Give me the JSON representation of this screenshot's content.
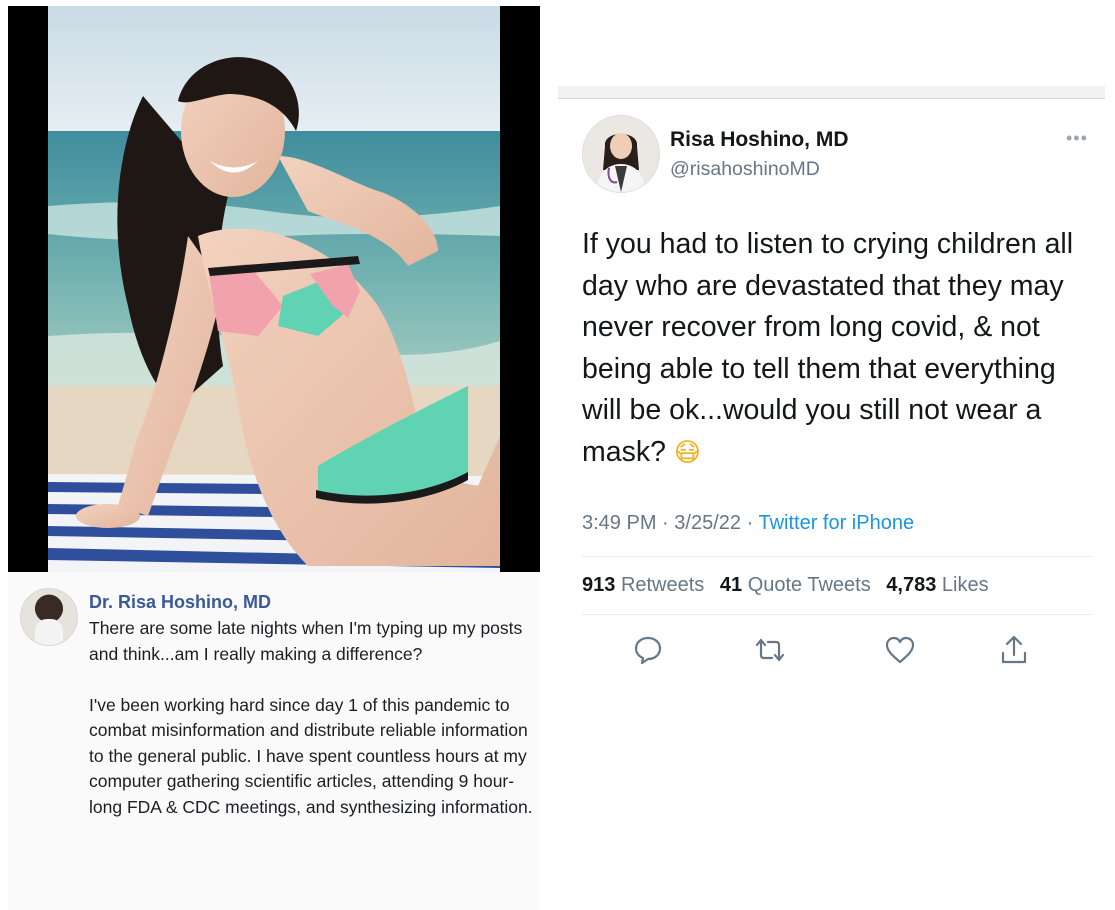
{
  "facebook_post": {
    "author": "Dr. Risa Hoshino, MD",
    "paragraphs": [
      "There are some late nights when I'm typing up my posts and think...am I really making a difference?",
      "I've been working hard since day 1 of this pandemic to combat misinformation and distribute reliable information to the general public. I have spent countless hours at my computer gathering scientific articles, attending 9 hour-long FDA & CDC meetings, and synthesizing information."
    ]
  },
  "tweet": {
    "name": "Risa Hoshino, MD",
    "handle": "@risahoshinoMD",
    "more_icon": "•••",
    "text": "If you had to listen to crying children all day who are devastated that they may never recover from long covid, & not being able to tell them that everything will be ok...would you still not wear a mask?",
    "emoji": "😷",
    "time": "3:49 PM",
    "date": "3/25/22",
    "dot": "·",
    "source": "Twitter for iPhone",
    "retweets_count": "913",
    "retweets_label": "Retweets",
    "quotes_count": "41",
    "quotes_label": "Quote Tweets",
    "likes_count": "4,783",
    "likes_label": "Likes",
    "actions": [
      "reply-icon",
      "retweet-icon",
      "like-icon",
      "share-icon"
    ]
  },
  "colors": {
    "fb_name": "#3b5998",
    "tweet_text": "#14171a",
    "tweet_secondary": "#657786",
    "tweet_link": "#1b95e0",
    "action_icon": "#657786"
  }
}
